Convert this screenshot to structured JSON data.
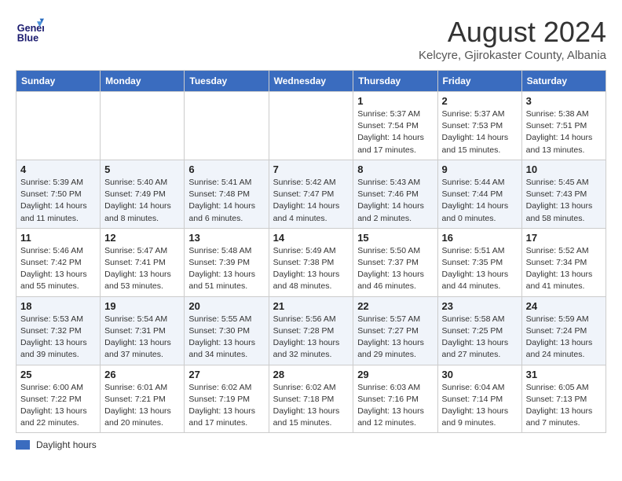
{
  "header": {
    "logo_line1": "General",
    "logo_line2": "Blue",
    "main_title": "August 2024",
    "subtitle": "Kelcyre, Gjirokaster County, Albania"
  },
  "days_of_week": [
    "Sunday",
    "Monday",
    "Tuesday",
    "Wednesday",
    "Thursday",
    "Friday",
    "Saturday"
  ],
  "weeks": [
    [
      {
        "day": "",
        "detail": ""
      },
      {
        "day": "",
        "detail": ""
      },
      {
        "day": "",
        "detail": ""
      },
      {
        "day": "",
        "detail": ""
      },
      {
        "day": "1",
        "detail": "Sunrise: 5:37 AM\nSunset: 7:54 PM\nDaylight: 14 hours\nand 17 minutes."
      },
      {
        "day": "2",
        "detail": "Sunrise: 5:37 AM\nSunset: 7:53 PM\nDaylight: 14 hours\nand 15 minutes."
      },
      {
        "day": "3",
        "detail": "Sunrise: 5:38 AM\nSunset: 7:51 PM\nDaylight: 14 hours\nand 13 minutes."
      }
    ],
    [
      {
        "day": "4",
        "detail": "Sunrise: 5:39 AM\nSunset: 7:50 PM\nDaylight: 14 hours\nand 11 minutes."
      },
      {
        "day": "5",
        "detail": "Sunrise: 5:40 AM\nSunset: 7:49 PM\nDaylight: 14 hours\nand 8 minutes."
      },
      {
        "day": "6",
        "detail": "Sunrise: 5:41 AM\nSunset: 7:48 PM\nDaylight: 14 hours\nand 6 minutes."
      },
      {
        "day": "7",
        "detail": "Sunrise: 5:42 AM\nSunset: 7:47 PM\nDaylight: 14 hours\nand 4 minutes."
      },
      {
        "day": "8",
        "detail": "Sunrise: 5:43 AM\nSunset: 7:46 PM\nDaylight: 14 hours\nand 2 minutes."
      },
      {
        "day": "9",
        "detail": "Sunrise: 5:44 AM\nSunset: 7:44 PM\nDaylight: 14 hours\nand 0 minutes."
      },
      {
        "day": "10",
        "detail": "Sunrise: 5:45 AM\nSunset: 7:43 PM\nDaylight: 13 hours\nand 58 minutes."
      }
    ],
    [
      {
        "day": "11",
        "detail": "Sunrise: 5:46 AM\nSunset: 7:42 PM\nDaylight: 13 hours\nand 55 minutes."
      },
      {
        "day": "12",
        "detail": "Sunrise: 5:47 AM\nSunset: 7:41 PM\nDaylight: 13 hours\nand 53 minutes."
      },
      {
        "day": "13",
        "detail": "Sunrise: 5:48 AM\nSunset: 7:39 PM\nDaylight: 13 hours\nand 51 minutes."
      },
      {
        "day": "14",
        "detail": "Sunrise: 5:49 AM\nSunset: 7:38 PM\nDaylight: 13 hours\nand 48 minutes."
      },
      {
        "day": "15",
        "detail": "Sunrise: 5:50 AM\nSunset: 7:37 PM\nDaylight: 13 hours\nand 46 minutes."
      },
      {
        "day": "16",
        "detail": "Sunrise: 5:51 AM\nSunset: 7:35 PM\nDaylight: 13 hours\nand 44 minutes."
      },
      {
        "day": "17",
        "detail": "Sunrise: 5:52 AM\nSunset: 7:34 PM\nDaylight: 13 hours\nand 41 minutes."
      }
    ],
    [
      {
        "day": "18",
        "detail": "Sunrise: 5:53 AM\nSunset: 7:32 PM\nDaylight: 13 hours\nand 39 minutes."
      },
      {
        "day": "19",
        "detail": "Sunrise: 5:54 AM\nSunset: 7:31 PM\nDaylight: 13 hours\nand 37 minutes."
      },
      {
        "day": "20",
        "detail": "Sunrise: 5:55 AM\nSunset: 7:30 PM\nDaylight: 13 hours\nand 34 minutes."
      },
      {
        "day": "21",
        "detail": "Sunrise: 5:56 AM\nSunset: 7:28 PM\nDaylight: 13 hours\nand 32 minutes."
      },
      {
        "day": "22",
        "detail": "Sunrise: 5:57 AM\nSunset: 7:27 PM\nDaylight: 13 hours\nand 29 minutes."
      },
      {
        "day": "23",
        "detail": "Sunrise: 5:58 AM\nSunset: 7:25 PM\nDaylight: 13 hours\nand 27 minutes."
      },
      {
        "day": "24",
        "detail": "Sunrise: 5:59 AM\nSunset: 7:24 PM\nDaylight: 13 hours\nand 24 minutes."
      }
    ],
    [
      {
        "day": "25",
        "detail": "Sunrise: 6:00 AM\nSunset: 7:22 PM\nDaylight: 13 hours\nand 22 minutes."
      },
      {
        "day": "26",
        "detail": "Sunrise: 6:01 AM\nSunset: 7:21 PM\nDaylight: 13 hours\nand 20 minutes."
      },
      {
        "day": "27",
        "detail": "Sunrise: 6:02 AM\nSunset: 7:19 PM\nDaylight: 13 hours\nand 17 minutes."
      },
      {
        "day": "28",
        "detail": "Sunrise: 6:02 AM\nSunset: 7:18 PM\nDaylight: 13 hours\nand 15 minutes."
      },
      {
        "day": "29",
        "detail": "Sunrise: 6:03 AM\nSunset: 7:16 PM\nDaylight: 13 hours\nand 12 minutes."
      },
      {
        "day": "30",
        "detail": "Sunrise: 6:04 AM\nSunset: 7:14 PM\nDaylight: 13 hours\nand 9 minutes."
      },
      {
        "day": "31",
        "detail": "Sunrise: 6:05 AM\nSunset: 7:13 PM\nDaylight: 13 hours\nand 7 minutes."
      }
    ]
  ],
  "legend": {
    "label": "Daylight hours"
  }
}
